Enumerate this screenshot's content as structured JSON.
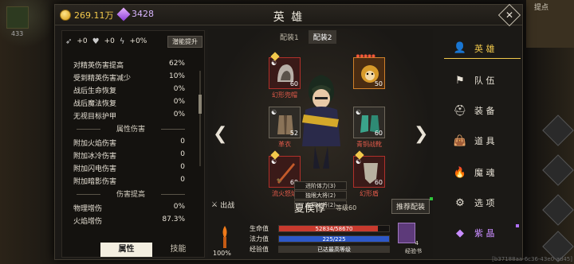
{
  "background": {
    "left_count": "433",
    "right_label": "提点",
    "session_id": "[b37188aa-6c36-43e0-ad45]"
  },
  "topbar": {
    "gold": "269.11万",
    "gems": "3428",
    "title": "英 雄",
    "close_icon": "close-icon"
  },
  "left": {
    "summary": {
      "atk_bonus": "+0",
      "hp_bonus": "+0",
      "pct_bonus": "+0%",
      "potential_button": "潜能提升"
    },
    "stats": [
      {
        "label": "对精英伤害提高",
        "value": "62%"
      },
      {
        "label": "受到精英伤害减少",
        "value": "10%"
      },
      {
        "label": "战后生命恢复",
        "value": "0%"
      },
      {
        "label": "战后魔法恢复",
        "value": "0%"
      },
      {
        "label": "无视目标护甲",
        "value": "0%"
      }
    ],
    "section_attr_damage": "属性伤害",
    "attr_stats": [
      {
        "label": "附加火焰伤害",
        "value": "0"
      },
      {
        "label": "附加冰冷伤害",
        "value": "0"
      },
      {
        "label": "附加闪电伤害",
        "value": "0"
      },
      {
        "label": "附加暗影伤害",
        "value": "0"
      }
    ],
    "section_damage_boost": "伤害提高",
    "boost_stats": [
      {
        "label": "物理增伤",
        "value": "0%"
      },
      {
        "label": "火焰增伤",
        "value": "87.3%"
      }
    ],
    "tabs": [
      "属性",
      "技能"
    ]
  },
  "center": {
    "loadouts": [
      "配装1",
      "配装2"
    ],
    "slots": {
      "helmet": {
        "name": "幻形兜帽",
        "level": "60"
      },
      "pet": {
        "name": "",
        "level": "50"
      },
      "armor": {
        "name": "革衣",
        "level": "52"
      },
      "boots": {
        "name": "青铜战靴",
        "level": "60"
      },
      "weapon": {
        "name": "流火怒焰",
        "level": "60"
      },
      "shield": {
        "name": "幻形盾",
        "level": "60"
      }
    },
    "skills": [
      "进阶体力(3)",
      "独眼大将(2)",
      "幽冥火将(2)"
    ],
    "deploy_label": "出战",
    "hero_name": "夏侯惇",
    "hero_level": "等级60",
    "recommend_button": "推荐配装",
    "torch_value": "100%",
    "hp": {
      "label": "生命值",
      "text": "52834/58670",
      "fraction": 0.9,
      "color": "#c83a2e"
    },
    "mp": {
      "label": "法力值",
      "text": "225/225",
      "fraction": 1.0,
      "color": "#2d58c8"
    },
    "xp": {
      "label": "经验值",
      "text": "已达最高等级",
      "fraction": 1.0,
      "color": "#3a3630"
    },
    "book_count": "4",
    "book_label": "经验书"
  },
  "menu": [
    {
      "label": "英 雄",
      "icon": "hero-icon",
      "active": true
    },
    {
      "label": "队 伍",
      "icon": "flag-icon"
    },
    {
      "label": "装 备",
      "icon": "helmet-icon"
    },
    {
      "label": "道 具",
      "icon": "bag-icon"
    },
    {
      "label": "魔 魂",
      "icon": "flame-icon"
    },
    {
      "label": "选 项",
      "icon": "gear-icon"
    },
    {
      "label": "紫 晶",
      "icon": "crystal-icon"
    }
  ]
}
